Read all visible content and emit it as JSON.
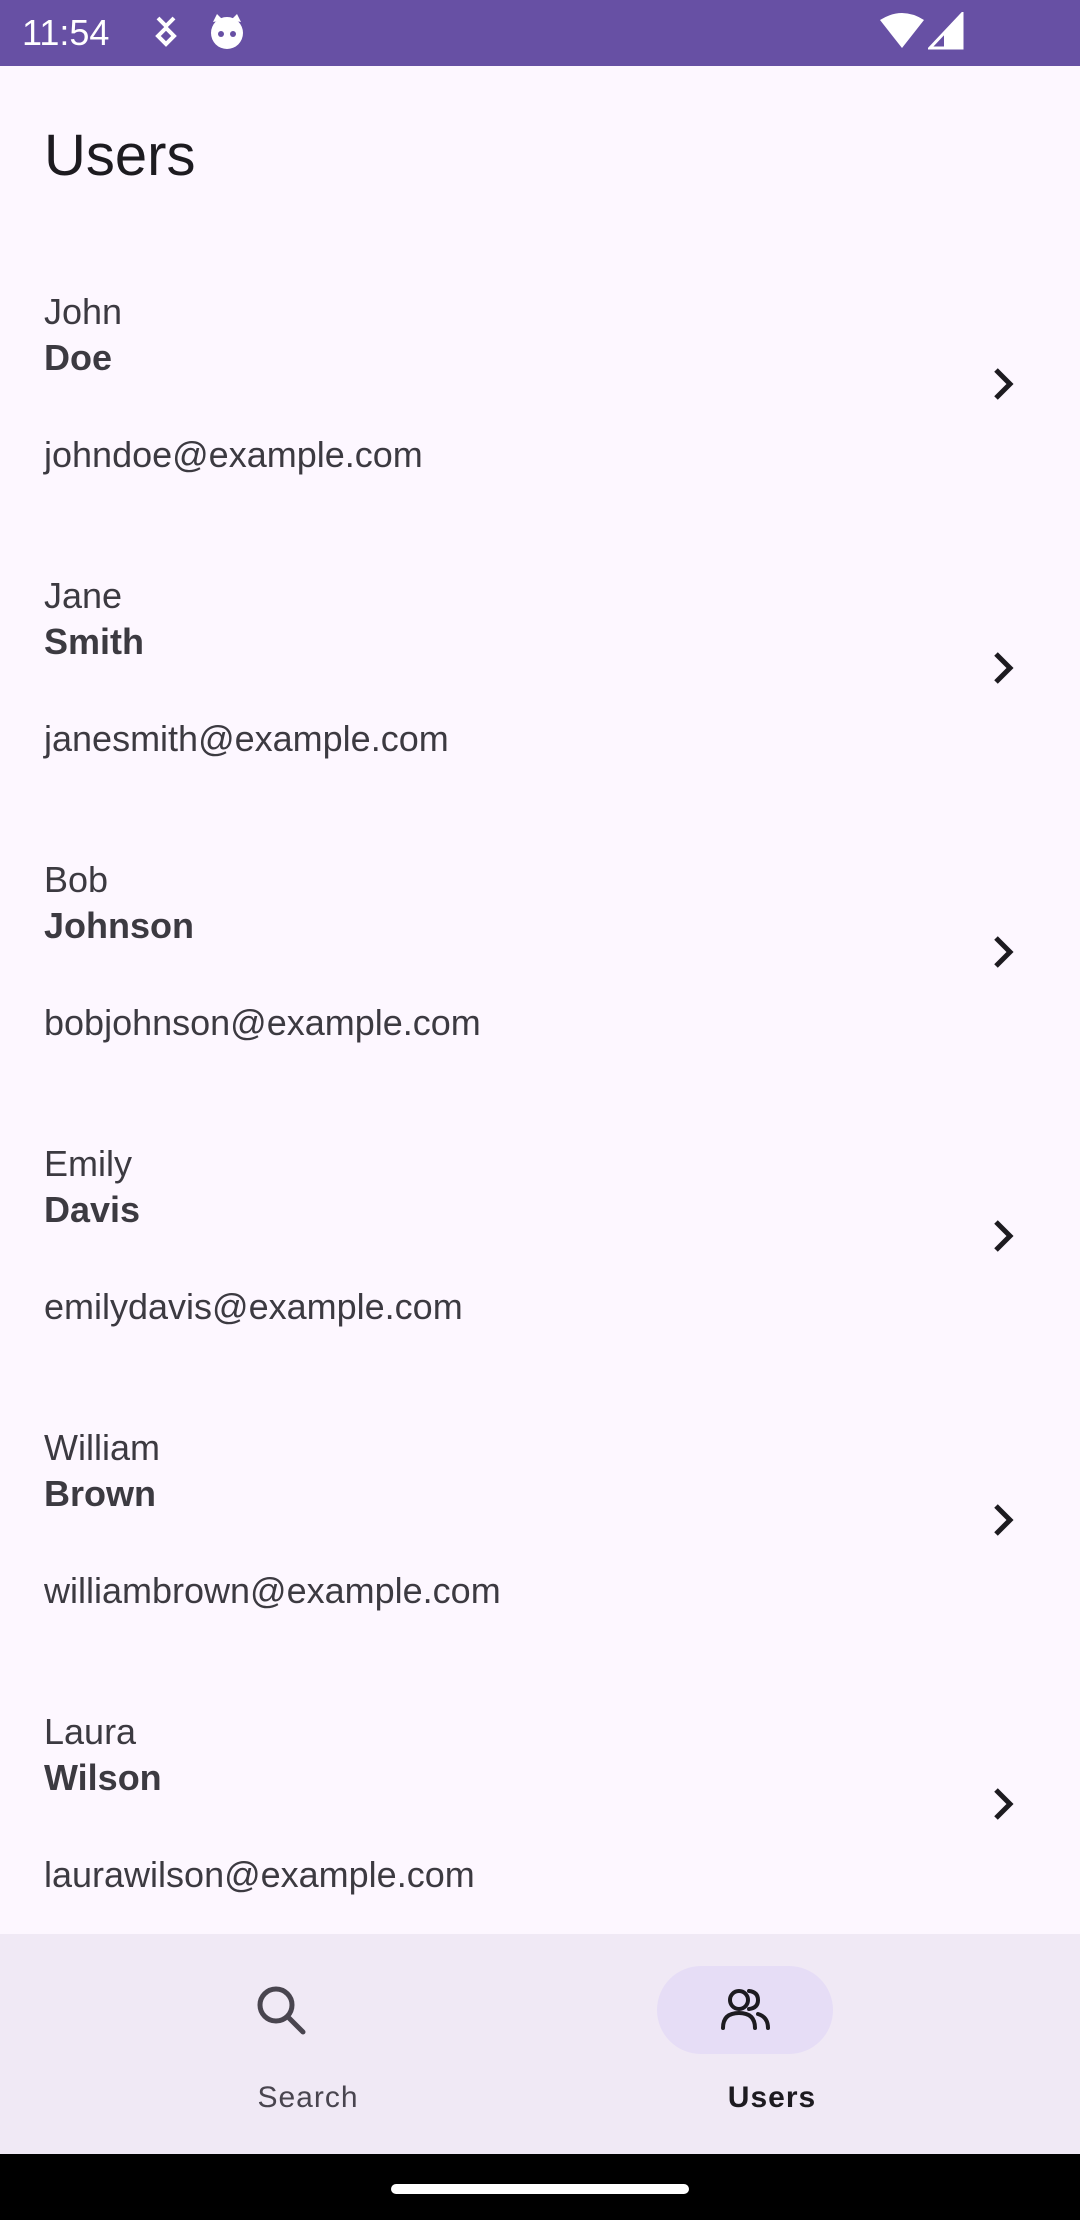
{
  "status_bar": {
    "time": "11:54",
    "background_color": "#6750a4",
    "left_icons": [
      "download-arrows-icon",
      "cat-face-icon"
    ],
    "right_icons": [
      "wifi-icon",
      "cellular-signal-icon"
    ]
  },
  "screen": {
    "title": "Users"
  },
  "users": [
    {
      "first_name": "John",
      "last_name": "Doe",
      "email": "johndoe@example.com"
    },
    {
      "first_name": "Jane",
      "last_name": "Smith",
      "email": "janesmith@example.com"
    },
    {
      "first_name": "Bob",
      "last_name": "Johnson",
      "email": "bobjohnson@example.com"
    },
    {
      "first_name": "Emily",
      "last_name": "Davis",
      "email": "emilydavis@example.com"
    },
    {
      "first_name": "William",
      "last_name": "Brown",
      "email": "williambrown@example.com"
    },
    {
      "first_name": "Laura",
      "last_name": "Wilson",
      "email": "laurawilson@example.com"
    }
  ],
  "bottom_nav": {
    "items": [
      {
        "label": "Search",
        "icon": "search-icon",
        "active": false
      },
      {
        "label": "Users",
        "icon": "users-icon",
        "active": true
      }
    ],
    "background_color": "#f0e9f5",
    "active_indicator_color": "#e6ddf6"
  }
}
